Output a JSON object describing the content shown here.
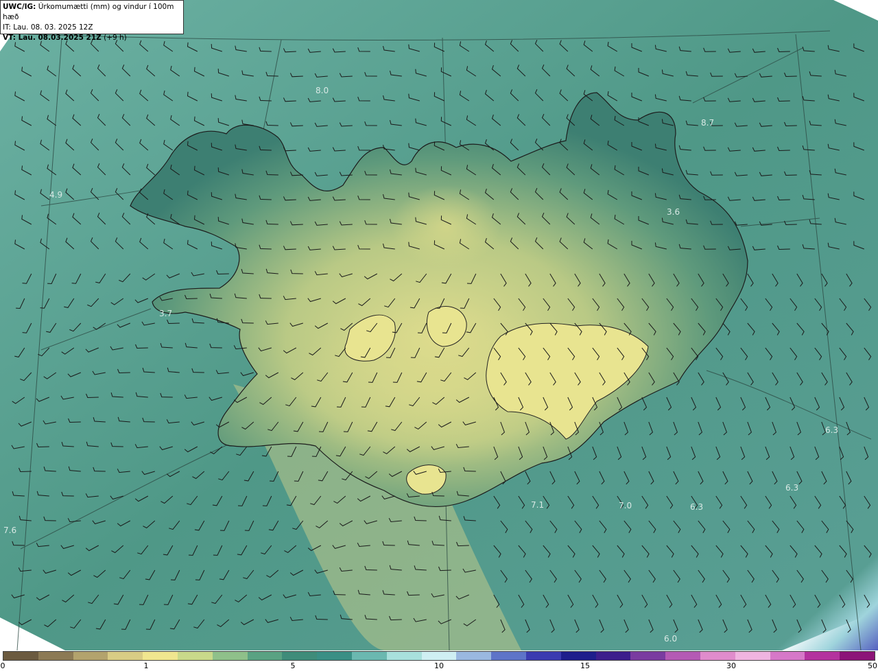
{
  "header": {
    "model": "UWC/IG:",
    "title": " Úrkomumætti (mm) og vindur í 100m hæð",
    "it": "IT: Lau. 08. 03. 2025 12Z",
    "vt_bold": "VT: Lau. 08.03.2025 21Z",
    "vt_lead": " (+9 h)"
  },
  "map_labels": [
    "8.0",
    "8.7",
    "3.6",
    "4.9",
    "3.7",
    "6.3",
    "6.3",
    "6.3",
    "7.1",
    "7.0",
    "7.6",
    "6.0"
  ],
  "colorbar": {
    "ticks": [
      "0",
      "1",
      "5",
      "10",
      "15",
      "30",
      "50"
    ],
    "colors": [
      "#6b5a3f",
      "#8c7a55",
      "#b3a36d",
      "#d9cc85",
      "#f0e68f",
      "#c9d98a",
      "#8fc08a",
      "#5aa283",
      "#3f8c7a",
      "#3a8f85",
      "#6bb8b0",
      "#a8e0dc",
      "#cfeff3",
      "#9ab8e0",
      "#5e74c8",
      "#3b3bb0",
      "#1e1e8c",
      "#3c1e8c",
      "#7a3ca0",
      "#b45ab4",
      "#e08ccc",
      "#f0b4e0",
      "#d678c8",
      "#b4329e",
      "#8c1478"
    ]
  },
  "colors": {
    "sea": "#5a9f90",
    "land_low": "#3d7f72",
    "land_high": "#e3e08e"
  }
}
